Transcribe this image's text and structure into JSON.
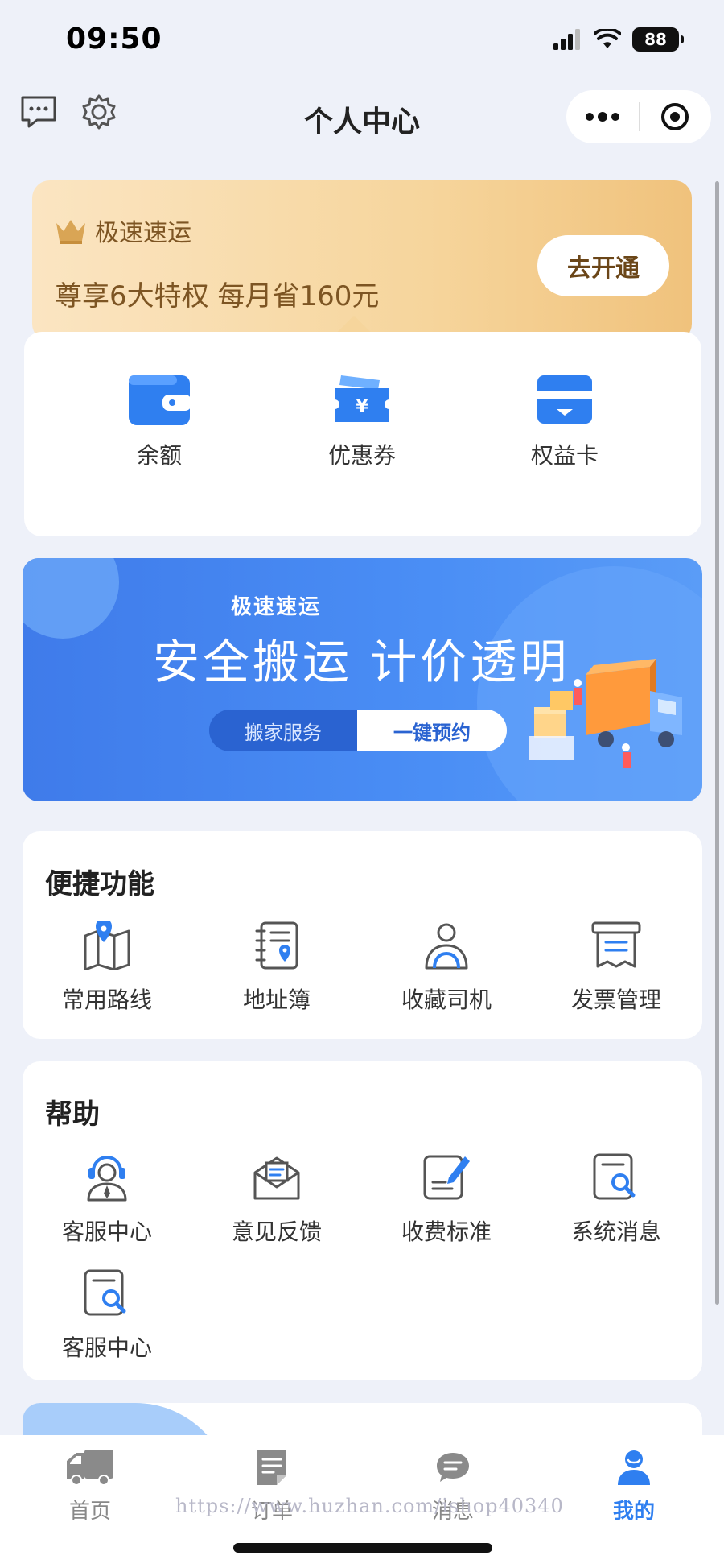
{
  "status_bar": {
    "time": "09:50",
    "battery": "88"
  },
  "nav": {
    "title": "个人中心"
  },
  "vip": {
    "brand": "极速速运",
    "description": "尊享6大特权 每月省160元",
    "button": "去开通",
    "colors": {
      "text": "#7d5523",
      "gradient_start": "#fbe5c2",
      "gradient_end": "#f0c27c"
    }
  },
  "wallet": [
    {
      "label": "余额",
      "icon": "wallet-icon"
    },
    {
      "label": "优惠券",
      "icon": "coupon-icon"
    },
    {
      "label": "权益卡",
      "icon": "card-icon"
    }
  ],
  "banner": {
    "brand": "极速速运",
    "slogan": "安全搬运  计价透明",
    "service": "搬家服务",
    "cta": "一键预约"
  },
  "quick": {
    "title": "便捷功能",
    "items": [
      {
        "label": "常用路线",
        "icon": "map-pin-icon"
      },
      {
        "label": "地址簿",
        "icon": "address-book-icon"
      },
      {
        "label": "收藏司机",
        "icon": "driver-icon"
      },
      {
        "label": "发票管理",
        "icon": "invoice-icon"
      }
    ]
  },
  "help": {
    "title": "帮助",
    "items": [
      {
        "label": "客服中心",
        "icon": "customer-service-icon"
      },
      {
        "label": "意见反馈",
        "icon": "feedback-mail-icon"
      },
      {
        "label": "收费标准",
        "icon": "pricing-doc-icon"
      },
      {
        "label": "系统消息",
        "icon": "search-doc-icon"
      },
      {
        "label": "客服中心",
        "icon": "search-doc-icon"
      }
    ]
  },
  "tabs": [
    {
      "label": "首页",
      "icon": "truck-icon"
    },
    {
      "label": "订单",
      "icon": "order-icon"
    },
    {
      "label": "消息",
      "icon": "message-icon"
    },
    {
      "label": "我的",
      "icon": "user-icon",
      "active": true
    }
  ],
  "watermark": "https://www.huzhan.com/ishop40340",
  "colors": {
    "accent": "#2f7ff0",
    "background": "#eef1f9"
  }
}
